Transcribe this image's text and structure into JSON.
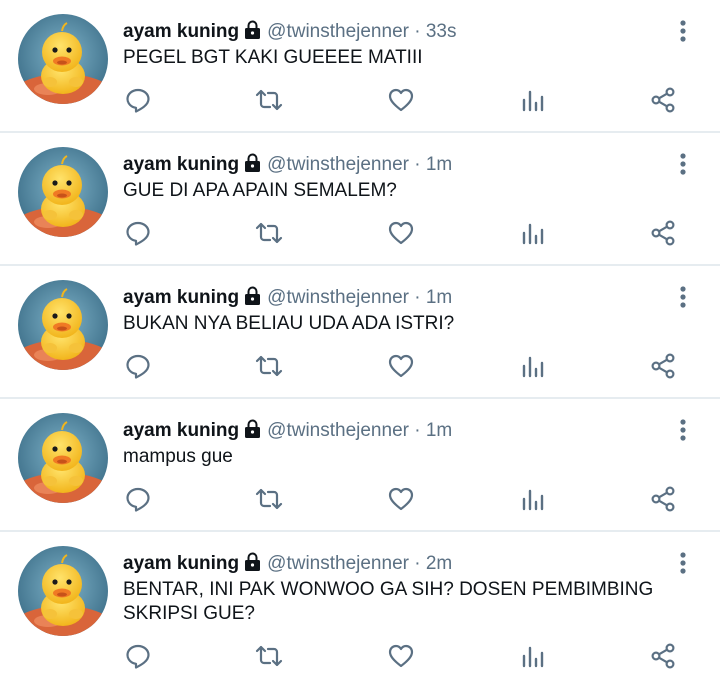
{
  "tweets": [
    {
      "name": "ayam kuning",
      "handle": "@twinsthejenner",
      "sep": " · ",
      "time": "33s",
      "text": "PEGEL BGT KAKI GUEEEE MATIII"
    },
    {
      "name": "ayam kuning",
      "handle": "@twinsthejenner",
      "sep": " · ",
      "time": "1m",
      "text": "GUE DI APA APAIN SEMALEM?"
    },
    {
      "name": "ayam kuning",
      "handle": "@twinsthejenner",
      "sep": " · ",
      "time": "1m",
      "text": "BUKAN NYA BELIAU UDA ADA ISTRI?"
    },
    {
      "name": "ayam kuning",
      "handle": "@twinsthejenner",
      "sep": " · ",
      "time": "1m",
      "text": "mampus gue"
    },
    {
      "name": "ayam kuning",
      "handle": "@twinsthejenner",
      "sep": " · ",
      "time": "2m",
      "text": "BENTAR, INI PAK WONWOO GA SIH? DOSEN PEMBIMBING SKRIPSI GUE?"
    }
  ],
  "icons": {
    "reply": "reply-icon",
    "retweet": "retweet-icon",
    "like": "like-icon",
    "analytics": "analytics-icon",
    "share": "share-icon",
    "more": "more-icon",
    "lock": "lock-icon"
  },
  "colors": {
    "icon": "#5b7083",
    "divider": "#e6ecf0",
    "text": "#0f1419",
    "handle": "#5b7083"
  }
}
